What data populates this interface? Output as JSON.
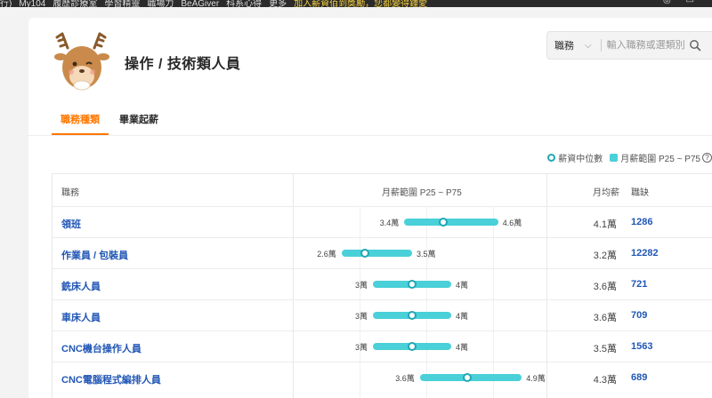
{
  "topnav": {
    "links": [
      "行)",
      "My104",
      "履歷診療室",
      "學習精靈",
      "職場力",
      "BeAGiver",
      "科系心得",
      "更多"
    ],
    "promo": "加入薪資佰到獎勵，您都變得鍾愛"
  },
  "header": {
    "title": "操作 / 技術類人員"
  },
  "search": {
    "selected": "職務",
    "placeholder": "輸入職務或選類別"
  },
  "tabs": [
    {
      "label": "職務種類",
      "active": true
    },
    {
      "label": "畢業起薪",
      "active": false
    }
  ],
  "legend": {
    "median_label": "薪資中位數",
    "range_label": "月薪範圍 P25 ~ P75",
    "help": "?"
  },
  "table": {
    "headers": {
      "job": "職務",
      "range": "月薪範圍 P25 ~ P75",
      "avg": "月均薪",
      "openings": "職缺"
    },
    "rows": [
      {
        "name": "領班",
        "p25_label": "3.4萬",
        "p75_label": "4.6萬",
        "avg": "4.1萬",
        "openings": "1286"
      },
      {
        "name": "作業員 / 包裝員",
        "p25_label": "2.6萬",
        "p75_label": "3.5萬",
        "avg": "3.2萬",
        "openings": "12282"
      },
      {
        "name": "銑床人員",
        "p25_label": "3萬",
        "p75_label": "4萬",
        "avg": "3.6萬",
        "openings": "721"
      },
      {
        "name": "車床人員",
        "p25_label": "3萬",
        "p75_label": "4萬",
        "avg": "3.6萬",
        "openings": "709"
      },
      {
        "name": "CNC機台操作人員",
        "p25_label": "3萬",
        "p75_label": "4萬",
        "avg": "3.5萬",
        "openings": "1563"
      },
      {
        "name": "CNC電腦程式編排人員",
        "p25_label": "3.6萬",
        "p75_label": "4.9萬",
        "avg": "4.3萬",
        "openings": "689"
      }
    ]
  },
  "salary_values": [
    {
      "p25": 3.4,
      "median": 3.9,
      "p75": 4.6
    },
    {
      "p25": 2.6,
      "median": 2.9,
      "p75": 3.5
    },
    {
      "p25": 3.0,
      "median": 3.5,
      "p75": 4.0
    },
    {
      "p25": 3.0,
      "median": 3.5,
      "p75": 4.0
    },
    {
      "p25": 3.0,
      "median": 3.5,
      "p75": 4.0
    },
    {
      "p25": 3.6,
      "median": 4.2,
      "p75": 4.9
    }
  ],
  "colors": {
    "accent": "#ff7800",
    "link": "#2157b5",
    "bar": "#4ad0d8",
    "median_ring": "#22a7b4"
  }
}
